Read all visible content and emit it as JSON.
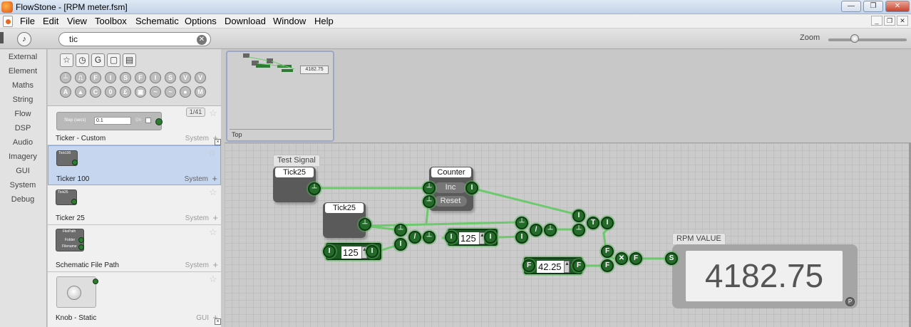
{
  "window": {
    "title": "FlowStone - [RPM meter.fsm]",
    "controls": {
      "minimize": "—",
      "maximize": "❐",
      "close": "✕"
    }
  },
  "menubar": {
    "items": [
      "File",
      "Edit",
      "View",
      "Toolbox",
      "Schematic",
      "Options",
      "Download",
      "Window",
      "Help"
    ],
    "mdi": {
      "minimize": "_",
      "restore": "❐",
      "close": "✕"
    }
  },
  "toolbar": {
    "search_value": "tic",
    "search_clear": "✕",
    "zoom_label": "Zoom",
    "zoom_level": 0.32
  },
  "categories": [
    "External",
    "Element",
    "Maths",
    "String",
    "Flow",
    "DSP",
    "Audio",
    "Imagery",
    "GUI",
    "System",
    "Debug"
  ],
  "filters": {
    "row1": [
      "☆",
      "◷",
      "G",
      "▢",
      "▤"
    ],
    "row2": [
      "┴",
      "⎍",
      "F",
      "I",
      "S",
      "F",
      "I",
      "S",
      "V",
      "V"
    ],
    "row3": [
      "A",
      "▲",
      "C",
      "0",
      "£",
      "▣",
      "~",
      "~",
      "●",
      "M"
    ]
  },
  "modules": [
    {
      "name": "Ticker - Custom",
      "category": "System",
      "plus": "+",
      "page": "1/41",
      "thumb_field": "0.1",
      "thumb_label": "Step (secs)",
      "thumb_on": "On"
    },
    {
      "name": "Ticker 100",
      "category": "System",
      "plus": "+",
      "thumb_label": "Tick100"
    },
    {
      "name": "Ticker 25",
      "category": "System",
      "plus": "+",
      "thumb_label": "Tick25"
    },
    {
      "name": "Schematic File Path",
      "category": "System",
      "plus": "+",
      "thumb_label": "FilePath",
      "thumb_ports": [
        "Folder",
        "Filename"
      ]
    },
    {
      "name": "Knob - Static",
      "category": "GUI",
      "plus": "+"
    }
  ],
  "navigator": {
    "label": "Top",
    "value": "4182.75"
  },
  "schematic": {
    "test_signal_label": "Test Signal",
    "tick_a": "Tick25",
    "tick_b": "Tick25",
    "counter": {
      "title": "Counter",
      "inc": "Inc",
      "reset": "Reset"
    },
    "int_box_1": "125",
    "int_box_2": "125",
    "float_box": "42.25",
    "rpm_label": "RPM VALUE",
    "rpm_value": "4182.75",
    "port_glyphs": {
      "trigger": "┴",
      "int": "I",
      "float": "F",
      "string": "S",
      "to_int": "T",
      "divide": "/",
      "multiply": "✕",
      "panel": "P"
    }
  },
  "colors": {
    "wire": "#6cc96c",
    "port": "#246b2a",
    "module_body": "#5a5a5a",
    "selection": "#c6d6ee"
  }
}
